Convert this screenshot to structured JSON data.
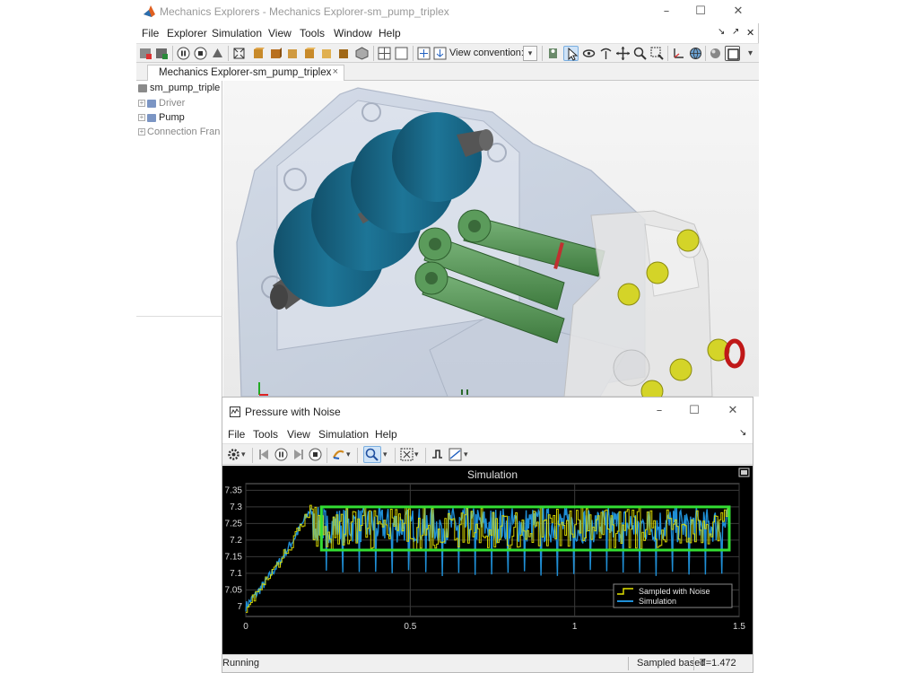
{
  "mechanics_explorer": {
    "title": "Mechanics Explorers - Mechanics Explorer-sm_pump_triplex",
    "menu": [
      "File",
      "Explorer",
      "Simulation",
      "View",
      "Tools",
      "Window",
      "Help"
    ],
    "view_convention_label": "View convention:",
    "tab_label": "Mechanics Explorer-sm_pump_triplex",
    "tab_close": "×",
    "tree": {
      "root": "sm_pump_triple",
      "items": [
        "Driver",
        "Pump",
        "Connection Fran"
      ]
    }
  },
  "scope": {
    "title": "Pressure with Noise",
    "menu": [
      "File",
      "Tools",
      "View",
      "Simulation",
      "Help"
    ],
    "status": {
      "left": "Running",
      "mode": "Sampled based",
      "time": "T=1.472"
    }
  },
  "chart_data": {
    "type": "line",
    "title": "Simulation",
    "xlim": [
      0,
      1.5
    ],
    "ylim": [
      6.97,
      7.37
    ],
    "x_ticks": [
      0,
      0.5,
      1,
      1.5
    ],
    "x_tick_labels": [
      "0",
      "0.5",
      "1",
      "1.5"
    ],
    "y_ticks": [
      7,
      7.05,
      7.1,
      7.15,
      7.2,
      7.25,
      7.3,
      7.35
    ],
    "y_tick_labels": [
      "7",
      "7.05",
      "7.1",
      "7.15",
      "7.2",
      "7.25",
      "7.3",
      "7.35"
    ],
    "grid": true,
    "legend_position": "bottom-right",
    "series": [
      {
        "name": "Sampled with Noise",
        "color": "#e6e600",
        "ramp": {
          "x": [
            0,
            0.05,
            0.1,
            0.15,
            0.2
          ],
          "y": [
            7.0,
            7.06,
            7.13,
            7.21,
            7.3
          ]
        },
        "steady_band": [
          7.17,
          7.3
        ],
        "end_time": 1.472
      },
      {
        "name": "Simulation",
        "color": "#1f8fd6",
        "ramp": {
          "x": [
            0,
            0.05,
            0.1,
            0.15,
            0.2
          ],
          "y": [
            7.0,
            7.06,
            7.13,
            7.21,
            7.3
          ]
        },
        "dip_value": 7.09,
        "dip_period": 0.05,
        "end_time": 1.472
      }
    ],
    "annotations": [
      {
        "type": "highlight-box",
        "color": "#33dd33",
        "x_range": [
          0.23,
          1.47
        ],
        "y_range": [
          7.17,
          7.3
        ]
      }
    ]
  },
  "colors": {
    "plot_bg": "#000000",
    "grid": "#3a3a3a",
    "tick_text": "#d8d8d8",
    "crank_blue": "#1c6f8f",
    "piston_green": "#5a9a5a",
    "valve_yellow": "#d6d62a"
  }
}
